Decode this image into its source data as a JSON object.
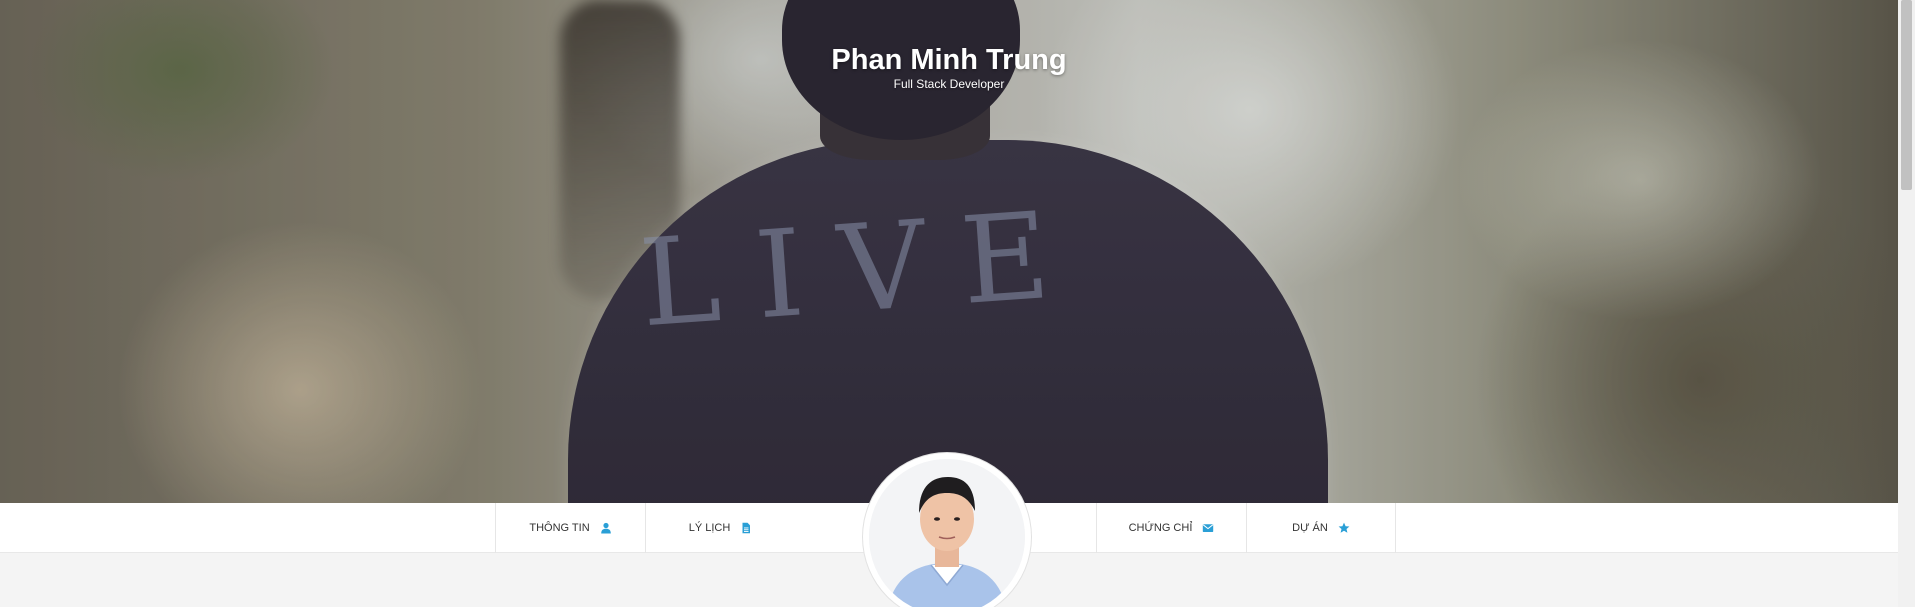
{
  "hero": {
    "title": "Phan Minh Trung",
    "subtitle": "Full Stack Developer",
    "shirt_text": "LIVE"
  },
  "nav": {
    "items": [
      {
        "label": "THÔNG TIN",
        "icon": "user-icon"
      },
      {
        "label": "LÝ LỊCH",
        "icon": "file-icon"
      },
      {
        "label": "CHỨNG CHỈ",
        "icon": "envelope-icon"
      },
      {
        "label": "DỰ ÁN",
        "icon": "star-icon"
      }
    ]
  },
  "colors": {
    "accent": "#2a9fd6",
    "nav_bg": "#ffffff",
    "page_bg": "#f4f4f4"
  },
  "avatar": {
    "icon": "profile-photo"
  }
}
